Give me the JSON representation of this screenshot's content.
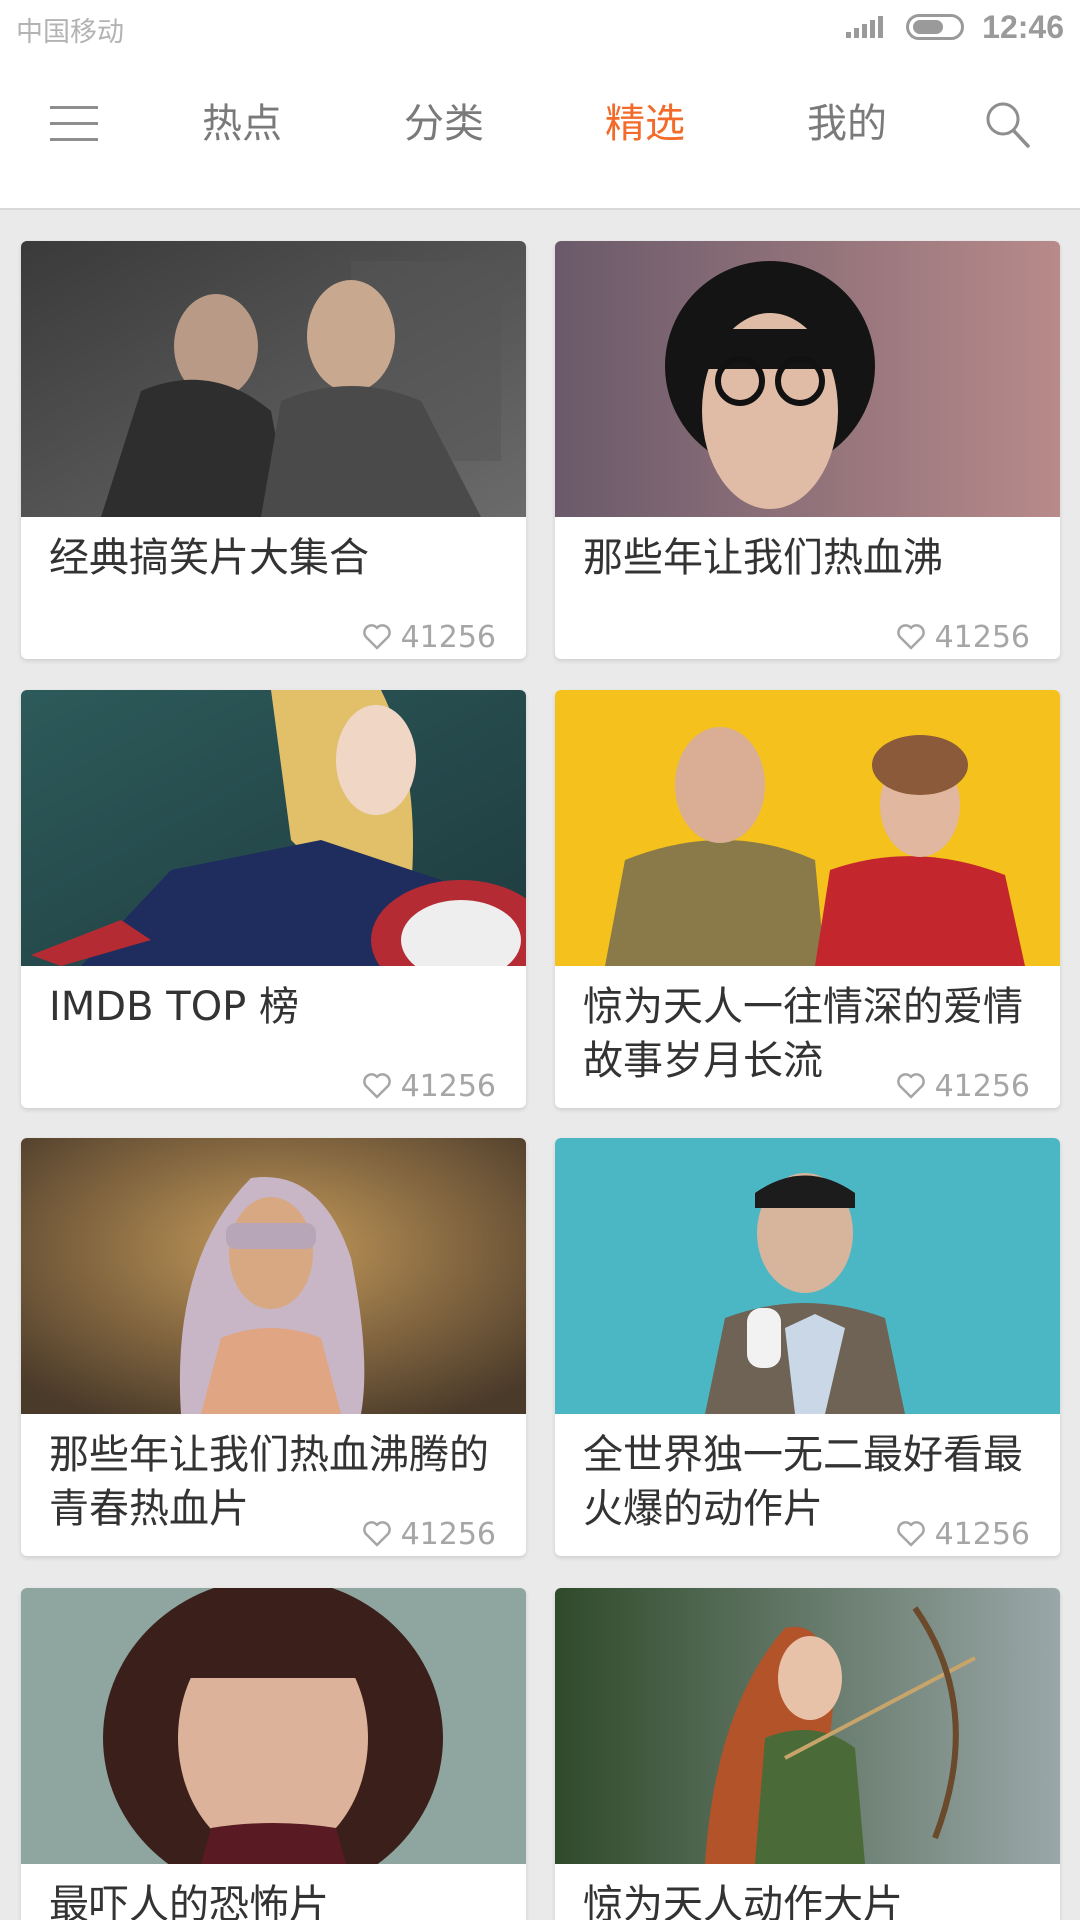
{
  "status_bar": {
    "carrier": "中国移动",
    "time": "12:46"
  },
  "nav": {
    "tabs": [
      {
        "label": "热点",
        "active": false
      },
      {
        "label": "分类",
        "active": false
      },
      {
        "label": "精选",
        "active": true
      },
      {
        "label": "我的",
        "active": false
      }
    ],
    "accent_color": "#f26b2a"
  },
  "cards": [
    {
      "title": "经典搞笑片大集合",
      "likes": "41256"
    },
    {
      "title": "那些年让我们热血沸",
      "likes": "41256"
    },
    {
      "title": "IMDB TOP 榜",
      "likes": "41256"
    },
    {
      "title": "惊为天人一往情深的爱情故事岁月长流",
      "likes": "41256"
    },
    {
      "title": "那些年让我们热血沸腾的青春热血片",
      "likes": "41256"
    },
    {
      "title": "全世界独一无二最好看最火爆的动作片",
      "likes": "41256"
    },
    {
      "title": "最吓人的恐怖片",
      "likes": ""
    },
    {
      "title": "惊为天人动作大片",
      "likes": ""
    }
  ]
}
